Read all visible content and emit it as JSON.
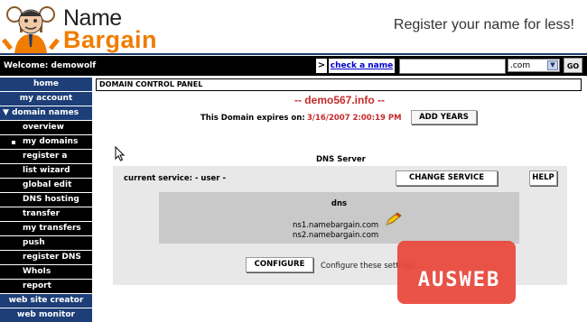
{
  "header": {
    "logo_line1": "Name",
    "logo_line2": "Bargain",
    "tagline": "Register your name for less!"
  },
  "topbar": {
    "welcome": "Welcome: demowolf",
    "arrow": ">",
    "check_link": "check a name",
    "search_value": "",
    "tld_selected": ".com",
    "go_label": "GO"
  },
  "sidebar": {
    "home": "home",
    "my_account": "my account",
    "domain_names": "domain names",
    "items": [
      "overview",
      "my domains",
      "register a name",
      "list wizard",
      "global edit",
      "DNS hosting",
      "transfer",
      "my transfers",
      "push",
      "register DNS",
      "WhoIs",
      "report"
    ],
    "web_site_creator": "web site creator",
    "web_monitor": "web monitor"
  },
  "main": {
    "panel_title": "DOMAIN CONTROL PANEL",
    "domain_title": "-- demo567.info --",
    "expires_label": "This Domain expires on:",
    "expires_date": "3/16/2007 2:00:19 PM",
    "add_years_button": "ADD YEARS",
    "dns_header": "DNS Server",
    "current_service": "current service: - user -",
    "change_service_button": "CHANGE SERVICE",
    "help_button": "HELP",
    "dns_label": "dns",
    "ns1": "ns1.namebargain.com",
    "ns2": "ns2.namebargain.com",
    "configure_button": "CONFIGURE",
    "configure_text": "Configure these settings..."
  },
  "watermark": {
    "text": "AUSWEB"
  },
  "colors": {
    "nav_blue": "#1d3e77",
    "brand_orange": "#f07c00",
    "domain_red": "#c62a2a",
    "watermark_red": "#e8463a"
  }
}
